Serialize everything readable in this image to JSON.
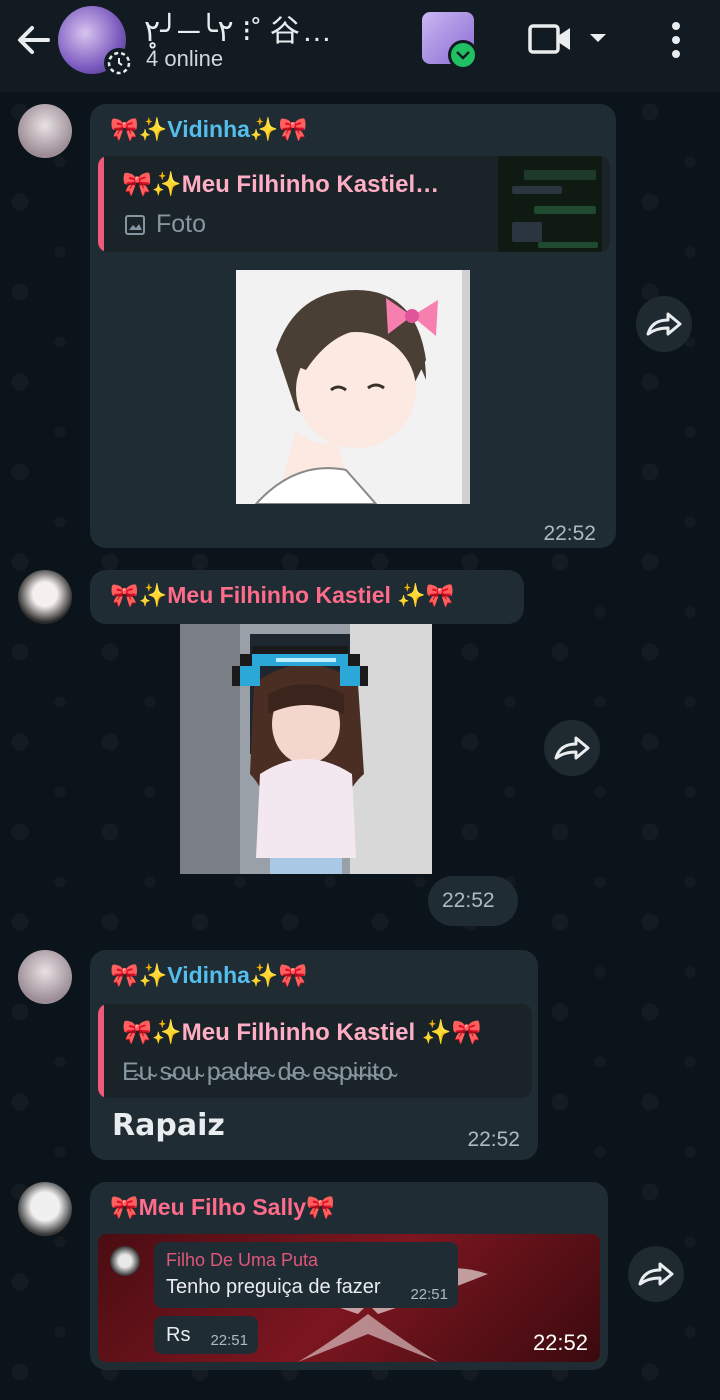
{
  "header": {
    "group_name": "٢╰─╯٢̥ ⁝˚ 谷…",
    "subtitle": "4 online"
  },
  "messages": [
    {
      "sender": "🎀✨Vidinha✨🎀",
      "quote_name": "🎀✨Meu Filhinho Kastiel…",
      "quote_text": "Foto",
      "time": "22:52"
    },
    {
      "sender": "🎀✨Meu Filhinho Kastiel ✨🎀",
      "time": "22:52"
    },
    {
      "sender": "🎀✨Vidinha✨🎀",
      "quote_name": "🎀✨Meu Filhinho Kastiel ✨🎀",
      "quote_text": "E̴u̴ s̴o̴u̴ p̴a̴d̴r̴e̴ d̴e̴ e̴s̴p̴i̴r̴i̴t̴o̴",
      "text": "𝗥𝗮𝗽𝗮𝗶𝘇",
      "time": "22:52"
    },
    {
      "sender": "🎀Meu Filho Sally🎀",
      "inner_name": "Filho De Uma Puta",
      "inner_text_1": "Tenho preguiça de fazer",
      "inner_time_1": "22:51",
      "inner_text_2": "Rs",
      "inner_time_2": "22:51",
      "time": "22:52"
    }
  ],
  "colors": {
    "bubble": "#202c33",
    "sender_teal": "#53bdeb",
    "sender_pink": "#ff6b8b",
    "quote_bar": "#ef5a7a"
  },
  "icons": [
    "back-arrow-icon",
    "status-icon",
    "video-call-icon",
    "caret-down-icon",
    "more-vert-icon",
    "forward-icon",
    "image-icon"
  ]
}
